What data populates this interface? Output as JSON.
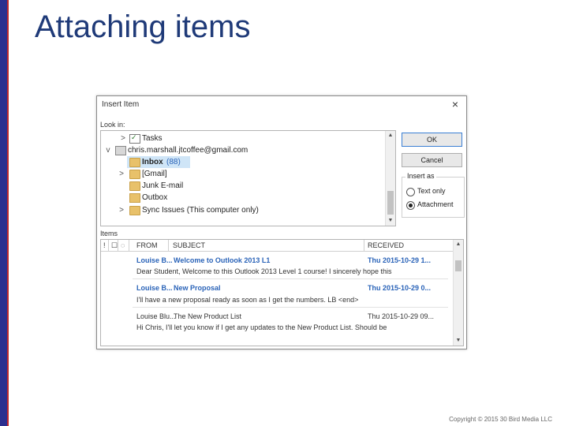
{
  "slide": {
    "title": "Attaching items",
    "copyright": "Copyright © 2015 30 Bird Media LLC"
  },
  "dialog": {
    "title": "Insert Item",
    "close_glyph": "×",
    "look_in_label": "Look in:",
    "folders": [
      {
        "label": "Tasks",
        "icon": "task-icon",
        "chevron": ">"
      },
      {
        "label": "chris.marshall.jtcoffee@gmail.com",
        "icon": "account-icon",
        "chevron": "v"
      },
      {
        "label": "Inbox",
        "count": "(88)",
        "icon": "folder-icon",
        "selected": true
      },
      {
        "label": "[Gmail]",
        "icon": "folder-icon",
        "chevron": ">"
      },
      {
        "label": "Junk E-mail",
        "icon": "folder-icon"
      },
      {
        "label": "Outbox",
        "icon": "outbox-icon"
      },
      {
        "label": "Sync Issues (This computer only)",
        "icon": "folder-icon",
        "chevron": ">"
      }
    ],
    "ok_label": "OK",
    "cancel_label": "Cancel",
    "insert_as_label": "Insert as",
    "insert_as_options": [
      {
        "label": "Text only",
        "selected": false
      },
      {
        "label": "Attachment",
        "selected": true
      }
    ],
    "items_label": "Items",
    "columns": {
      "importance": "!",
      "type": "☐",
      "attach": "◌",
      "from": "FROM",
      "subject": "SUBJECT",
      "received": "RECEIVED"
    },
    "messages": [
      {
        "from": "Louise B...",
        "subject": "Welcome to Outlook 2013 L1",
        "received": "Thu 2015-10-29 1...",
        "preview": "Dear Student, Welcome to this Outlook 2013 Level 1 course! I sincerely hope this",
        "unread": true
      },
      {
        "from": "Louise B...",
        "subject": "New Proposal",
        "received": "Thu 2015-10-29 0...",
        "preview": "I'll have a new proposal ready as soon as I get the numbers. LB <end>",
        "unread": true
      },
      {
        "from": "Louise Blu...",
        "subject": "The New Product List",
        "received": "Thu 2015-10-29 09...",
        "preview": "Hi Chris, I'll let you know if I get any updates to the New Product List. Should be",
        "unread": false
      }
    ]
  }
}
